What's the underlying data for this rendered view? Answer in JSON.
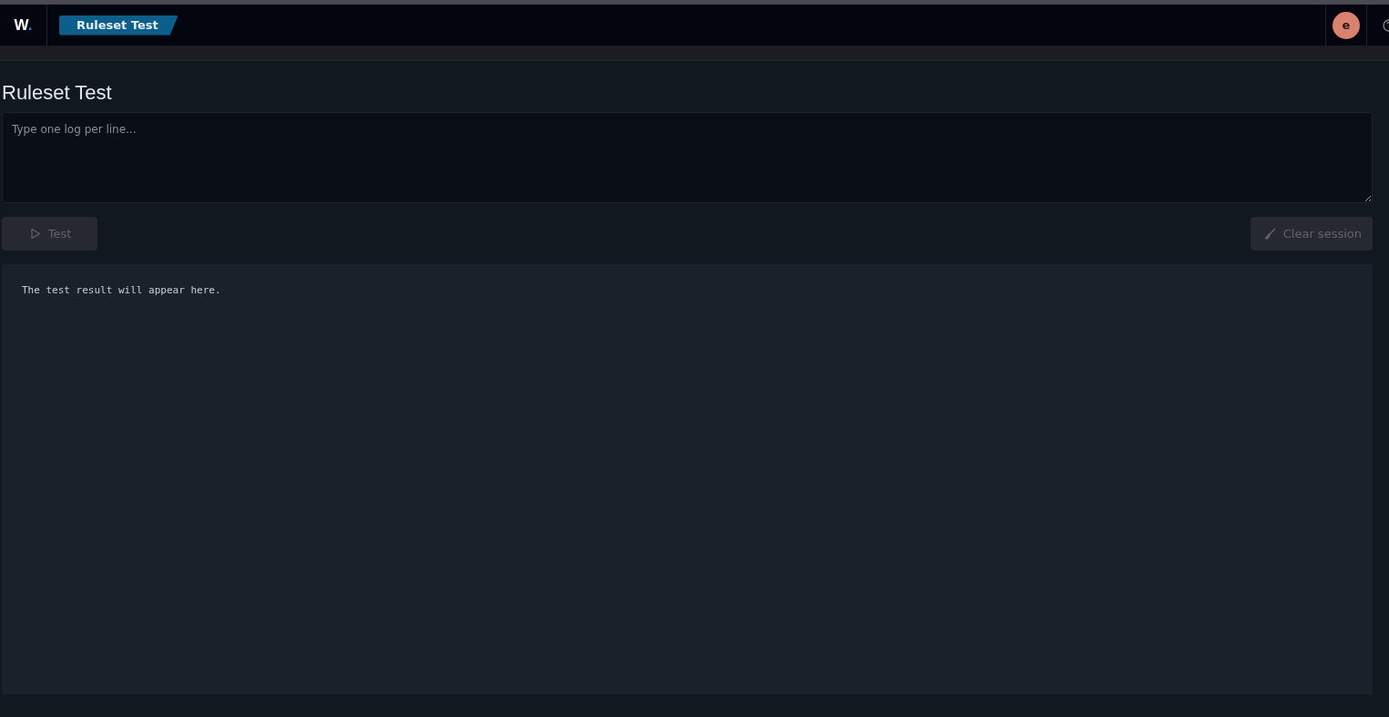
{
  "header": {
    "logo": "W.",
    "breadcrumb": "Ruleset Test",
    "avatar": "e"
  },
  "page": {
    "title": "Ruleset Test"
  },
  "log_input": {
    "placeholder": "Type one log per line..."
  },
  "buttons": [
    {
      "kind": "test",
      "label": "Test",
      "disabled": true
    },
    {
      "kind": "clear",
      "label": "Clear session",
      "disabled": true
    }
  ],
  "result": {
    "text": "The test result will appear here."
  }
}
